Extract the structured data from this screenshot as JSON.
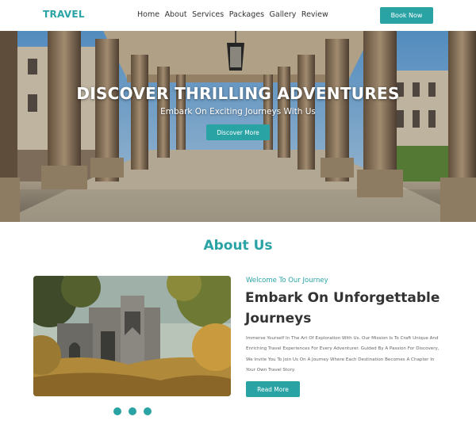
{
  "nav": {
    "brand": "TRAVEL",
    "links": [
      "Home",
      "About",
      "Services",
      "Packages",
      "Gallery",
      "Review"
    ],
    "book_label": "Book Now"
  },
  "hero": {
    "title": "DISCOVER THRILLING ADVENTURES",
    "subtitle": "Embark On Exciting Journeys With Us",
    "cta_label": "Discover More"
  },
  "about": {
    "section_title": "About Us",
    "kicker": "Welcome To Our Journey",
    "heading": "Embark On Unforgettable Journeys",
    "body": "Immerse Yourself In The Art Of Exploration With Us. Our Mission Is To Craft Unique And Enriching Travel Experiences For Every Adventurer. Guided By A Passion For Discovery, We Invite You To Join Us On A Journey Where Each Destination Becomes A Chapter In Your Own Travel Story.",
    "read_more_label": "Read More",
    "carousel_dot_count": 3
  },
  "colors": {
    "accent": "#2aa3a5",
    "text_dark": "#333333",
    "text_muted": "#666666"
  }
}
